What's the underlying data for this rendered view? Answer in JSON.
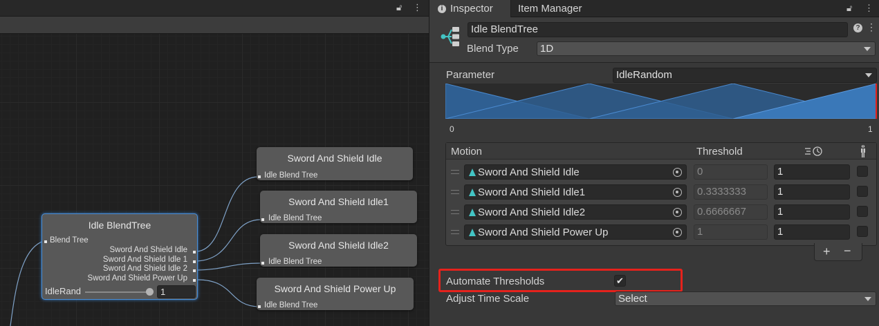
{
  "graph": {
    "nodes": {
      "root": {
        "title": "Idle BlendTree",
        "input_label": "Blend Tree",
        "outputs": [
          "Sword And Shield Idle",
          "Sword And Shield Idle 1",
          "Sword And Shield Idle 2",
          "Sword And Shield Power Up"
        ],
        "param_label": "IdleRand",
        "param_value": "1",
        "slider_level": 1.0
      },
      "children": [
        {
          "title": "Sword And Shield Idle",
          "input_label": "Idle Blend Tree"
        },
        {
          "title": "Sword And Shield Idle1",
          "input_label": "Idle Blend Tree"
        },
        {
          "title": "Sword And Shield Idle2",
          "input_label": "Idle Blend Tree"
        },
        {
          "title": "Sword And Shield Power Up",
          "input_label": "Idle Blend Tree"
        }
      ]
    },
    "colors": {
      "wire": "#7fa2c8",
      "selection": "#4a90d9"
    }
  },
  "inspector": {
    "tabs": {
      "inspector": "Inspector",
      "item_manager": "Item Manager"
    },
    "icons": [
      "info-icon",
      "lock-icon",
      "more-menu-icon",
      "help-icon",
      "settings-icon",
      "blendtree-icon"
    ],
    "name": "Idle BlendTree",
    "blend_type_label": "Blend Type",
    "blend_type_value": "1D",
    "parameter_label": "Parameter",
    "parameter_value": "IdleRandom",
    "range_min": "0",
    "range_max": "1",
    "motion_header": {
      "motion": "Motion",
      "threshold": "Threshold"
    },
    "motions": [
      {
        "name": "Sword And Shield Idle",
        "threshold": "0",
        "speed": "1",
        "mirror": false
      },
      {
        "name": "Sword And Shield Idle1",
        "threshold": "0.3333333",
        "speed": "1",
        "mirror": false
      },
      {
        "name": "Sword And Shield Idle2",
        "threshold": "0.6666667",
        "speed": "1",
        "mirror": false
      },
      {
        "name": "Sword And Shield Power Up",
        "threshold": "1",
        "speed": "1",
        "mirror": false
      }
    ],
    "list_buttons": {
      "add": "+",
      "remove": "−"
    },
    "automate_thresholds_label": "Automate Thresholds",
    "automate_thresholds_checked": true,
    "adjust_time_scale_label": "Adjust Time Scale",
    "adjust_time_scale_value": "Select",
    "colors": {
      "highlight": "#e5221c",
      "blend_fill": "#2f6aa3",
      "accent_teal": "#43c4c4"
    }
  }
}
